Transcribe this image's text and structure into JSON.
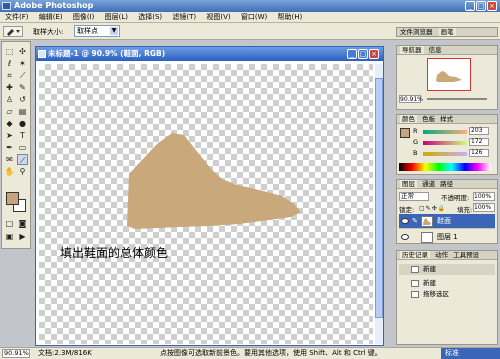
{
  "window": {
    "title": "Adobe Photoshop",
    "minimize": "_",
    "maximize": "□",
    "close": "×"
  },
  "menu": [
    "文件(F)",
    "编辑(E)",
    "图像(I)",
    "图层(L)",
    "选择(S)",
    "滤镜(T)",
    "视图(V)",
    "窗口(W)",
    "帮助(H)"
  ],
  "options": {
    "sample_size_label": "取样大小:",
    "sample_size_value": "取样点"
  },
  "file_browser_tab": "文件浏览器",
  "brushes_tab": "画笔",
  "document": {
    "title": "未标题-1 @ 90.9% (鞋面, RGB)"
  },
  "caption": "填出鞋面的总体颜色",
  "colors": {
    "foreground": "#c7a47a",
    "shoe_fill": "#c9a97c",
    "accent": "#3b65b6"
  },
  "navigator": {
    "tabs": [
      "导航器",
      "信息"
    ],
    "zoom": "90.91%"
  },
  "color_panel": {
    "tabs": [
      "颜色",
      "色板",
      "样式"
    ],
    "channels": [
      {
        "label": "R",
        "value": "203"
      },
      {
        "label": "G",
        "value": "172"
      },
      {
        "label": "B",
        "value": "126"
      }
    ]
  },
  "layers": {
    "tabs": [
      "图层",
      "通道",
      "路径"
    ],
    "blend_mode": "正常",
    "opacity_label": "不透明度:",
    "opacity": "100%",
    "lock_label": "锁定:",
    "fill_label": "填充:",
    "fill": "100%",
    "items": [
      {
        "name": "鞋面",
        "active": true
      },
      {
        "name": "图层 1",
        "active": false
      }
    ]
  },
  "history": {
    "tabs": [
      "历史记录",
      "动作",
      "工具预设"
    ],
    "items": [
      "新建",
      "新建",
      "拖移选区"
    ]
  },
  "status": {
    "zoom": "90.91%",
    "doc_size": "文档:2.3M/816K",
    "hint": "点按图像可选取新前景色。要用其他选项，使用 Shift、Alt 和 Ctrl 键。",
    "ime": "标准"
  }
}
